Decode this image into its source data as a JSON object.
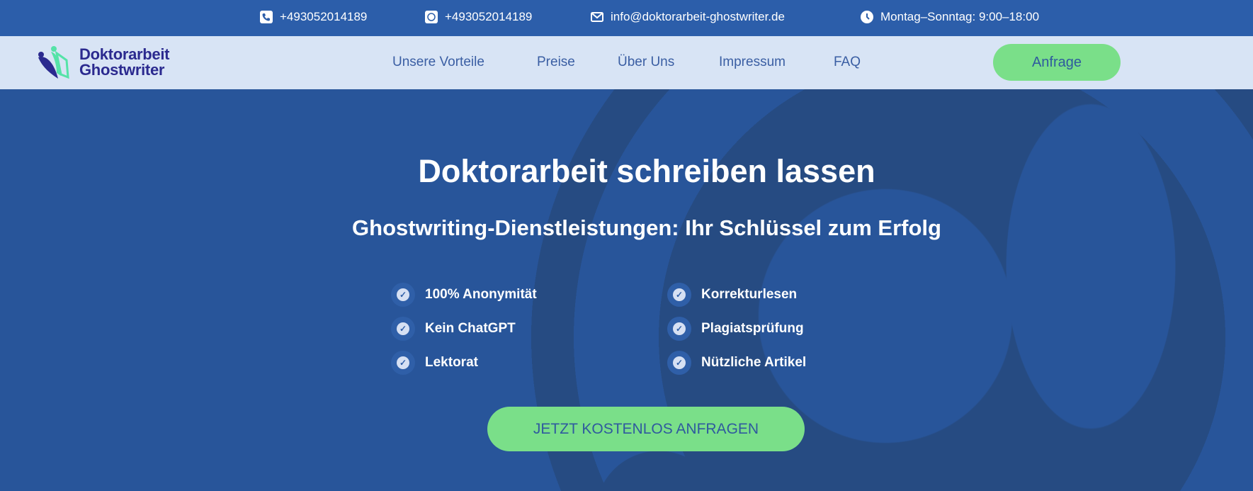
{
  "topbar": {
    "phone": "+493052014189",
    "whatsapp": "+493052014189",
    "email": "info@doktorarbeit-ghostwriter.de",
    "hours": "Montag–Sonntag: 9:00–18:00"
  },
  "nav": {
    "logo_line1": "Doktorarbeit",
    "logo_line2": "Ghostwriter",
    "links": [
      "Unsere Vorteile",
      "Preise",
      "Über Uns",
      "Impressum",
      "FAQ"
    ],
    "button": "Anfrage"
  },
  "hero": {
    "title": "Doktorarbeit schreiben lassen",
    "subtitle": "Ghostwriting-Dienstleistungen: Ihr Schlüssel zum Erfolg",
    "features_left": [
      "100% Anonymität",
      "Kein ChatGPT",
      "Lektorat"
    ],
    "features_right": [
      "Korrekturlesen",
      "Plagiatsprüfung",
      "Nützliche Artikel"
    ],
    "cta": "JETZT KOSTENLOS ANFRAGEN"
  },
  "colors": {
    "accent_green": "#7adf89",
    "topbar": "#2c5eaa",
    "hero": "#27559a",
    "nav_bg": "#d8e4f5"
  }
}
